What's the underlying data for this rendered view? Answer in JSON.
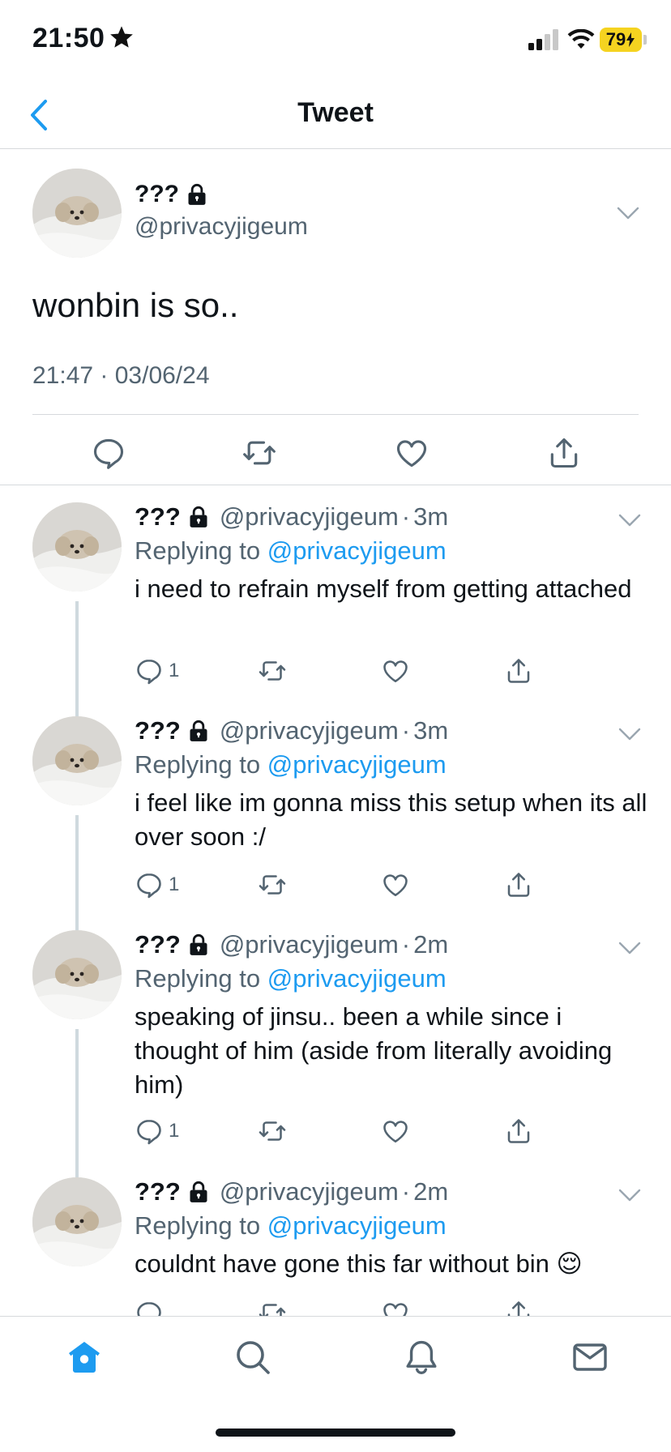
{
  "status": {
    "time": "21:50",
    "battery": "79"
  },
  "nav": {
    "title": "Tweet"
  },
  "main_tweet": {
    "name": "???",
    "handle": "@privacyjigeum",
    "text": "wonbin is so..",
    "timestamp": "21:47 · 03/06/24"
  },
  "replies": [
    {
      "name": "???",
      "handle": "@privacyjigeum",
      "dot": "·",
      "age": "3m",
      "replying_prefix": "Replying to",
      "replying_to": "@privacyjigeum",
      "text": "i need to refrain myself from getting attached",
      "reply_count": "1"
    },
    {
      "name": "???",
      "handle": "@privacyjigeum",
      "dot": "·",
      "age": "3m",
      "replying_prefix": "Replying to",
      "replying_to": "@privacyjigeum",
      "text": "i feel like im gonna miss this setup when its all over soon :/",
      "reply_count": "1"
    },
    {
      "name": "???",
      "handle": "@privacyjigeum",
      "dot": "·",
      "age": "2m",
      "replying_prefix": "Replying to",
      "replying_to": "@privacyjigeum",
      "text": "speaking of jinsu.. been a while since i thought of him (aside from literally avoiding him)",
      "reply_count": "1"
    },
    {
      "name": "???",
      "handle": "@privacyjigeum",
      "dot": "·",
      "age": "2m",
      "replying_prefix": "Replying to",
      "replying_to": "@privacyjigeum",
      "text": "couldnt have gone this far without bin 😌",
      "reply_count": ""
    }
  ],
  "icons": {
    "back": "chevron-left-icon",
    "reply": "speech-bubble-icon",
    "retweet": "retweet-icon",
    "like": "heart-icon",
    "share": "share-icon",
    "home": "home-icon",
    "search": "search-icon",
    "notifications": "bell-icon",
    "messages": "mail-icon"
  },
  "colors": {
    "accent": "#1d9bf0",
    "text": "#0f1419",
    "muted": "#536471",
    "battery": "#f5d320"
  }
}
